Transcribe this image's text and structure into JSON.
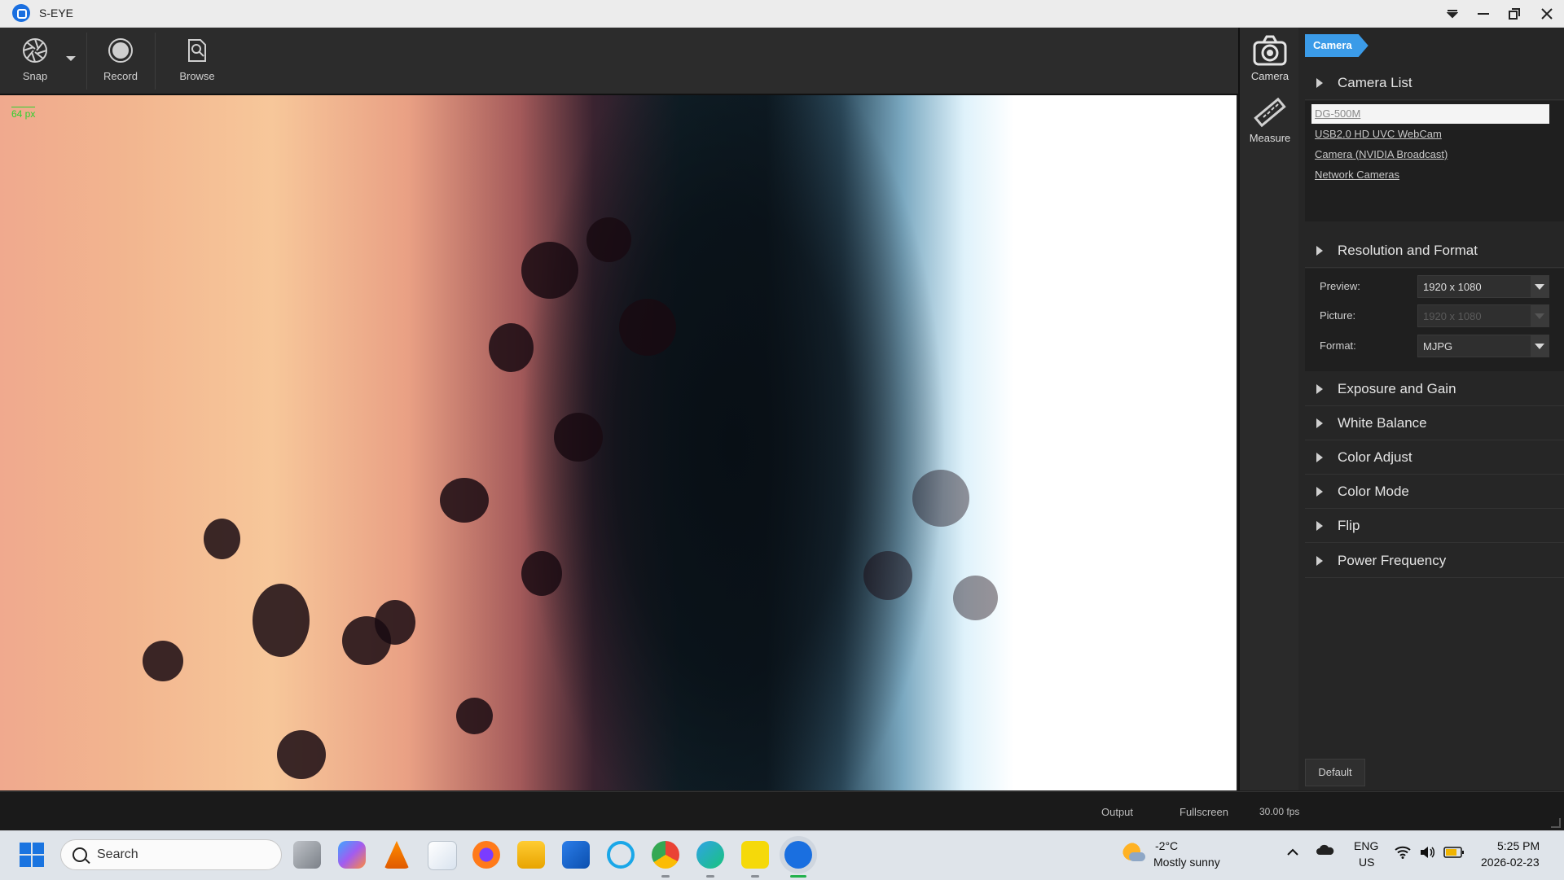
{
  "window": {
    "title": "S-EYE"
  },
  "toolbar": {
    "snap_label": "Snap",
    "record_label": "Record",
    "browse_label": "Browse"
  },
  "viewport": {
    "scale_label": "64 px"
  },
  "side_tabs": [
    {
      "label": "Camera",
      "icon": "camera-icon"
    },
    {
      "label": "Measure",
      "icon": "ruler-icon"
    }
  ],
  "panel": {
    "breadcrumb": "Camera",
    "sections": {
      "camera_list": "Camera List",
      "resolution": "Resolution and Format",
      "exposure": "Exposure and Gain",
      "white_balance": "White Balance",
      "color_adjust": "Color Adjust",
      "color_mode": "Color Mode",
      "flip": "Flip",
      "power_frequency": "Power Frequency"
    },
    "cameras": [
      "DG-500M",
      "USB2.0 HD UVC WebCam",
      "Camera (NVIDIA Broadcast)",
      "Network Cameras"
    ],
    "selected_camera": "DG-500M",
    "resolution_rows": [
      {
        "label": "Preview:",
        "value": "1920 x 1080",
        "disabled": false
      },
      {
        "label": "Picture:",
        "value": "1920 x 1080",
        "disabled": true
      },
      {
        "label": "Format:",
        "value": "MJPG",
        "disabled": false
      }
    ],
    "default_button": "Default"
  },
  "statusbar": {
    "output": "Output",
    "fullscreen": "Fullscreen",
    "fps": "30.00 fps"
  },
  "taskbar": {
    "search_placeholder": "Search",
    "weather_temp": "-2°C",
    "weather_desc": "Mostly sunny",
    "lang_primary": "ENG",
    "lang_secondary": "US",
    "time": "5:25 PM",
    "date": "2026-02-23"
  },
  "colors": {
    "accent": "#3b9be8",
    "panel_bg": "#262626",
    "toolbar_bg": "#2c2c2c",
    "scale_green": "#2fd12f"
  }
}
